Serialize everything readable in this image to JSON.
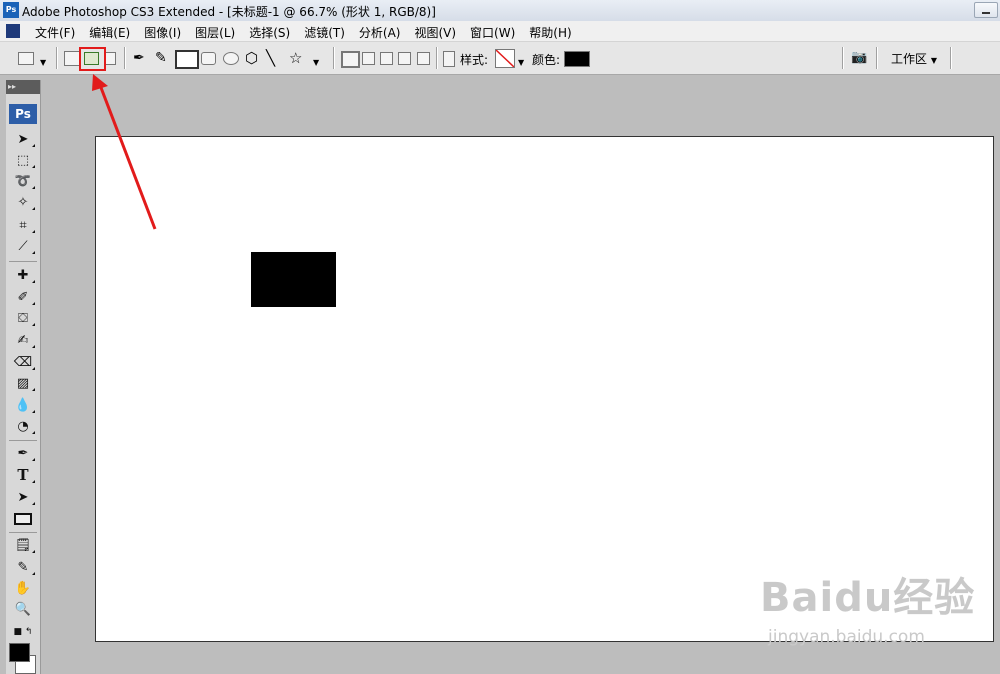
{
  "window": {
    "title": "Adobe Photoshop CS3 Extended - [未标题-1 @ 66.7% (形状 1, RGB/8)]",
    "app_icon": "Ps"
  },
  "menu": {
    "items": [
      "文件(F)",
      "编辑(E)",
      "图像(I)",
      "图层(L)",
      "选择(S)",
      "滤镜(T)",
      "分析(A)",
      "视图(V)",
      "窗口(W)",
      "帮助(H)"
    ]
  },
  "options": {
    "style_label": "样式:",
    "color_label": "颜色:",
    "color_value": "#000000",
    "workspace_label": "工作区"
  },
  "toolbox": {
    "logo": "Ps"
  },
  "document": {
    "shape_color": "#000000"
  },
  "annotation": {
    "highlight_color": "#e21b1b"
  },
  "watermark": {
    "brand": "Baidu经验",
    "url": "jingyan.baidu.com"
  }
}
